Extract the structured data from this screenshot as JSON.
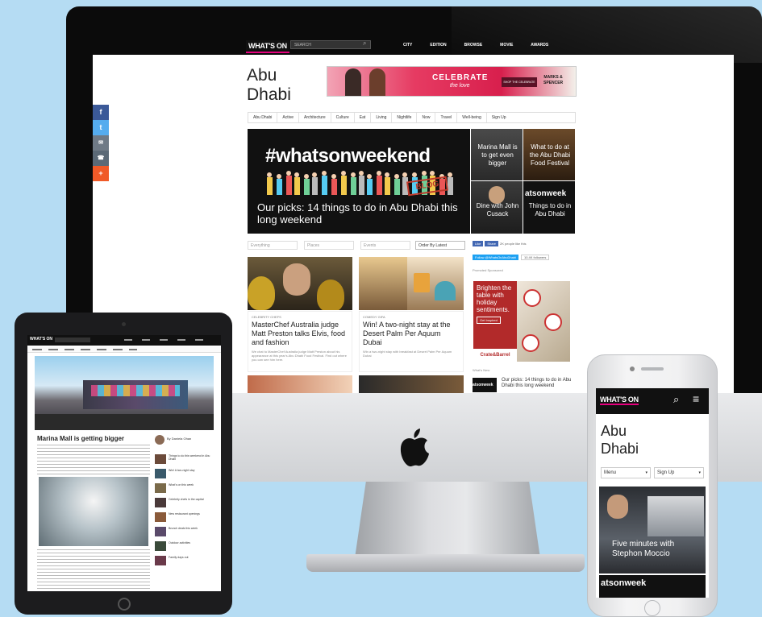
{
  "desktop": {
    "header": {
      "logo": "WHAT'S ON",
      "search_placeholder": "SEARCH",
      "nav": [
        "CITY",
        "EDITION",
        "BROWSE",
        "MOVIE",
        "AWARDS"
      ]
    },
    "city_title_line1": "Abu",
    "city_title_line2": "Dhabi",
    "ad": {
      "headline": "CELEBRATE",
      "script": "the love",
      "button": "SHOP THE CELEBRATE",
      "brand_line1": "MARKS &",
      "brand_line2": "SPENCER"
    },
    "menu": [
      "Abu Dhabi",
      "Active",
      "Architecture",
      "Culture",
      "Eat",
      "Living",
      "Nightlife",
      "Now",
      "Travel",
      "Well-being",
      "Sign Up"
    ],
    "hero": {
      "hashtag": "#whatsonweekend",
      "caption": "Our picks: 14 things to do in Abu Dhabi this long weekend",
      "stamp": "BLOG"
    },
    "tiles": [
      {
        "title": "Marina Mall is to get even bigger"
      },
      {
        "title": "What to do at the Abu Dhabi Food Festival"
      },
      {
        "title": "Dine with John Cusack"
      },
      {
        "title": "Things to do in Abu Dhabi"
      }
    ],
    "tile_overlay": "atsonweek",
    "filters": [
      "Everything",
      "Places",
      "Events",
      "Order By Latest"
    ],
    "social": {
      "like": "Like",
      "share": "Share",
      "count": "2K people like this",
      "follow": "Follow @WhatsOnAbuDhabi",
      "followers": "10.4K followers"
    },
    "promoted_label": "Promoted Sponsored",
    "cards": [
      {
        "category": "CELEBRITY CHEFS",
        "title": "MasterChef Australia judge Matt Preston talks Elvis, food and fashion",
        "summary": "We chat to MasterChef Australia judge Matt Preston about his appearance at this year's Abu Dhabi Food Festival. Find out where you can see him here."
      },
      {
        "category": "COMEDY GIFA",
        "title": "Win! A two-night stay at the Desert Palm Per Aquum Dubai",
        "summary": "Win a two-night stay with breakfast at Desert Palm Per Aquum Dubai"
      }
    ],
    "side_ad": {
      "text": "Brighten the table with holiday sentiments.",
      "button": "Get Inspired",
      "brand": "Crate&Barrel"
    },
    "whats_new_label": "What's New",
    "whats_new_item": "Our picks: 14 things to do in Abu Dhabi this long weekend",
    "whats_new_thumb": "atsonweek",
    "share_buttons": [
      "f",
      "t",
      "✉",
      "☎",
      "+"
    ],
    "colors": {
      "facebook": "#3b5998",
      "twitter": "#55acee",
      "email": "#6f7a86",
      "whatsapp": "#5b6976",
      "plus": "#f05a28",
      "brand_pink": "#e6007e"
    }
  },
  "tablet": {
    "logo": "WHAT'S ON",
    "article_title": "Marina Mall is getting bigger",
    "author": "By Daniela Ohan",
    "sidebar_items": [
      "Things to do this weekend in Abu Dhabi",
      "Win! A two-night stay",
      "What's on this week",
      "Celebrity chefs in the capital",
      "New restaurant openings",
      "Brunch deals this week",
      "Outdoor activities",
      "Family days out"
    ]
  },
  "phone": {
    "logo": "WHAT'S ON",
    "title_line1": "Abu",
    "title_line2": "Dhabi",
    "menu_label": "Menu",
    "signup_label": "Sign Up",
    "feature_caption": "Five minutes with Stephon Moccio",
    "overlay": "atsonweek"
  }
}
